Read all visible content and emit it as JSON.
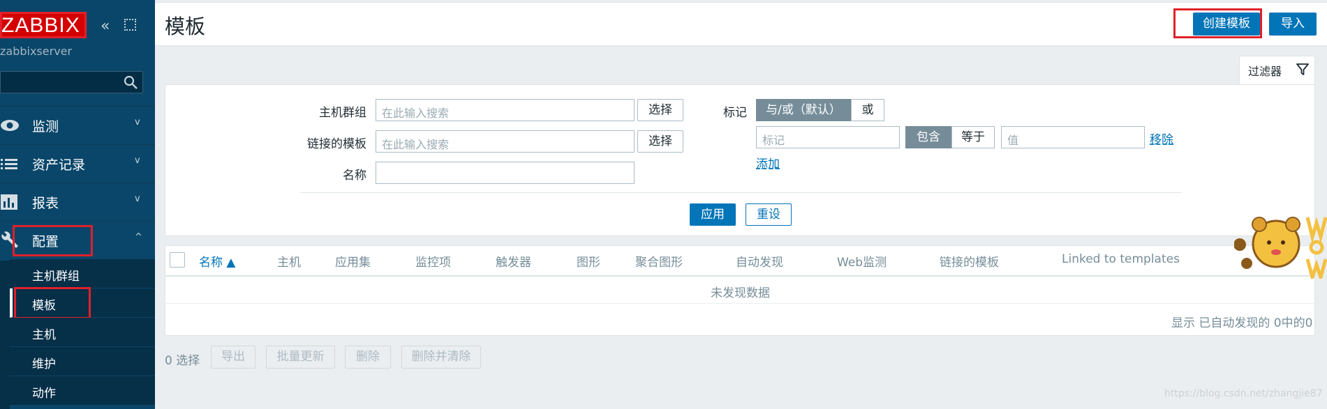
{
  "brand": {
    "logo": "ZABBIX",
    "server": "zabbixserver"
  },
  "sidebar": {
    "menu": [
      {
        "label": "监测",
        "icon": "eye-icon"
      },
      {
        "label": "资产记录",
        "icon": "list-icon"
      },
      {
        "label": "报表",
        "icon": "bar-chart-icon"
      },
      {
        "label": "配置",
        "icon": "wrench-icon"
      }
    ],
    "submenu": [
      "主机群组",
      "模板",
      "主机",
      "维护",
      "动作"
    ]
  },
  "header": {
    "title": "模板",
    "create_label": "创建模板",
    "import_label": "导入"
  },
  "filter": {
    "tab_label": "过滤器",
    "host_groups_label": "主机群组",
    "linked_templates_label": "链接的模板",
    "name_label": "名称",
    "search_placeholder": "在此输入搜索",
    "select_label": "选择",
    "tags_label": "标记",
    "tag_and_or": "与/或（默认）",
    "tag_or": "或",
    "tag_placeholder": "标记",
    "op_contains": "包含",
    "op_equals": "等于",
    "value_placeholder": "值",
    "remove_label": "移除",
    "add_label": "添加",
    "apply_label": "应用",
    "reset_label": "重设"
  },
  "table": {
    "columns": [
      "名称 ▲",
      "主机",
      "应用集",
      "监控项",
      "触发器",
      "图形",
      "聚合图形",
      "自动发现",
      "Web监测",
      "链接的模板",
      "Linked to templates"
    ],
    "empty_text": "未发现数据",
    "footer": "显示 已自动发现的 0中的0"
  },
  "bulk": {
    "selected": "0 选择",
    "actions": [
      "导出",
      "批量更新",
      "删除",
      "删除并清除"
    ]
  },
  "watermark": "https://blog.csdn.net/zhangjie87",
  "colors": {
    "sidebar": "#0a466a",
    "accent": "#0275b8",
    "logo_bg": "#d40000",
    "highlight": "#e0202a"
  }
}
